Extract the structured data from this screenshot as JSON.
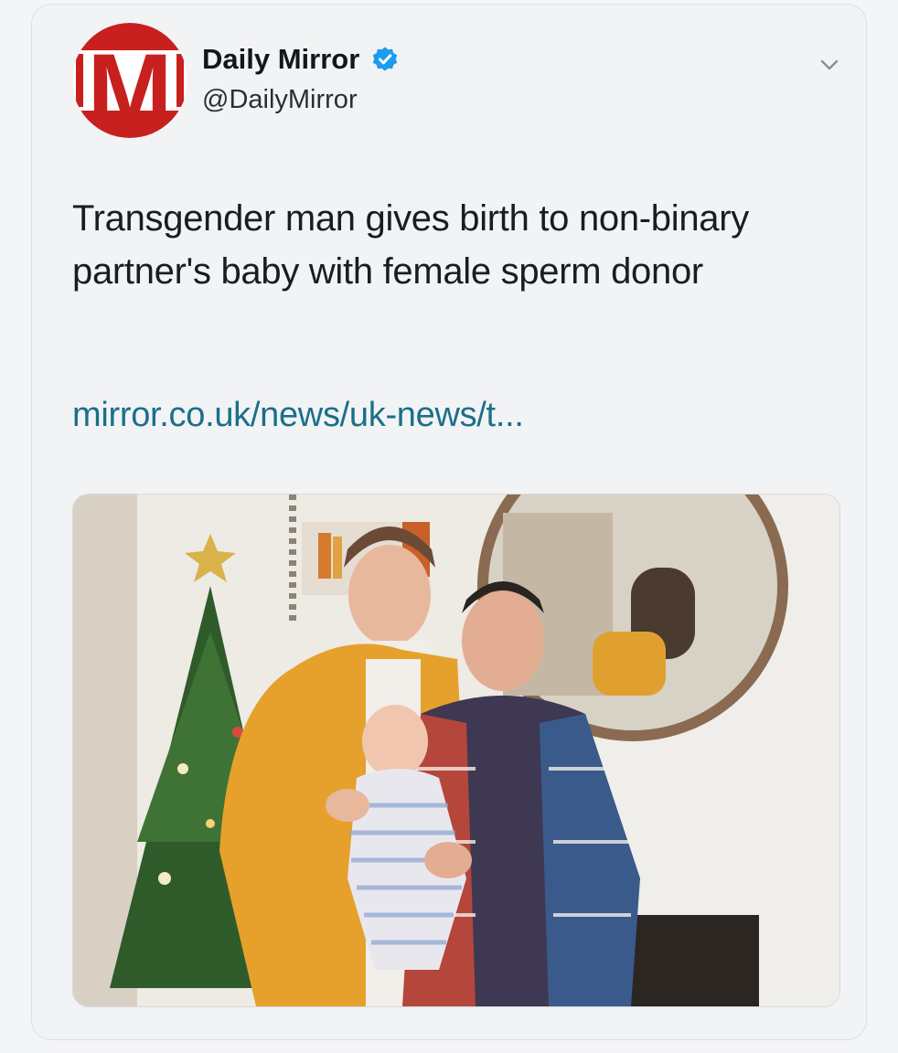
{
  "tweet": {
    "author": {
      "display_name": "Daily Mirror",
      "handle": "@DailyMirror",
      "avatar_letter": "M",
      "avatar_icon": "daily-mirror-logo",
      "verified_icon": "verified-badge-icon"
    },
    "menu_icon": "chevron-down-icon",
    "text": "Transgender man gives birth to non-binary partner's baby with female sperm donor",
    "link": "mirror.co.uk/news/uk-news/t...",
    "media": {
      "type": "photo",
      "icon": "photo-family-christmas-tree"
    }
  },
  "colors": {
    "brand_red": "#c8201f",
    "verified_blue": "#1d9bf0",
    "link_color": "#1b6f8a",
    "text_color": "#1a1d20",
    "card_background": "#f2f3f5"
  }
}
